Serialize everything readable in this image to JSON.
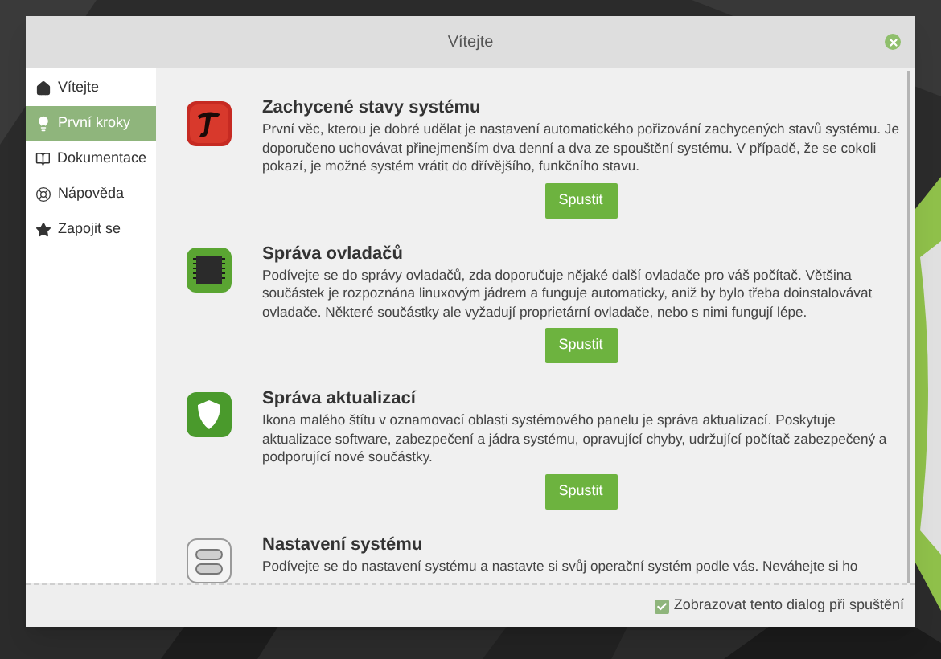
{
  "window": {
    "title": "Vítejte"
  },
  "sidebar": {
    "items": [
      {
        "label": "Vítejte",
        "selected": false
      },
      {
        "label": "První kroky",
        "selected": true
      },
      {
        "label": "Dokumentace",
        "selected": false
      },
      {
        "label": "Nápověda",
        "selected": false
      },
      {
        "label": "Zapojit se",
        "selected": false
      }
    ]
  },
  "sections": [
    {
      "title": "Zachycené stavy systému",
      "description": "První věc, kterou je dobré udělat je nastavení automatického pořizování zachycených stavů systému. Je doporučeno uchovávat přinejmenším dva denní a dva ze spouštění systému. V případě, že se cokoli pokazí, je možné systém vrátit do dřívějšího, funkčního stavu.",
      "button": "Spustit"
    },
    {
      "title": "Správa ovladačů",
      "description": "Podívejte se do správy ovladačů, zda doporučuje nějaké další ovladače pro váš počítač. Většina součástek je rozpoznána linuxovým jádrem a funguje automaticky, aniž by bylo třeba doinstalovávat ovladače. Některé součástky ale vyžadují proprietární ovladače, nebo s nimi fungují lépe.",
      "button": "Spustit"
    },
    {
      "title": "Správa aktualizací",
      "description": "Ikona malého štítu v oznamovací oblasti systémového panelu je správa aktualizací. Poskytuje aktualizace software, zabezpečení a jádra systému, opravující chyby, udržující počítač zabezpečený a podporující nové součástky.",
      "button": "Spustit"
    },
    {
      "title": "Nastavení systému",
      "description": "Podívejte se do nastavení systému a nastavte si svůj operační systém podle vás. Neváhejte si ho"
    }
  ],
  "footer": {
    "checkbox": {
      "label": "Zobrazovat tento dialog při spuštění",
      "checked": true
    }
  }
}
